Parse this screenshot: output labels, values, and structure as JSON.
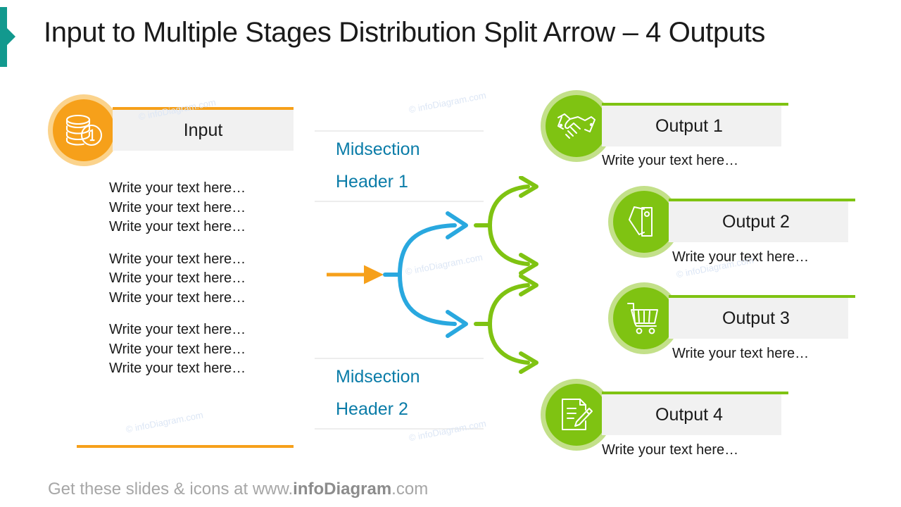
{
  "title": "Input to Multiple Stages Distribution Split Arrow – 4 Outputs",
  "colors": {
    "accent_teal": "#12998E",
    "input_orange": "#F6A01A",
    "input_orange_light": "#FBD38C",
    "mid_blue": "#0A7CA8",
    "arrow_blue": "#29A8DF",
    "output_green": "#7FC312",
    "output_green_light": "#C3E08A",
    "box_gray": "#F1F1F1",
    "rule_gray": "#EDEDED"
  },
  "input": {
    "icon": "coins-stack-icon",
    "label": "Input",
    "text_groups": [
      [
        "Write your text here…",
        "Write your text here…",
        "Write your text here…"
      ],
      [
        "Write your text here…",
        "Write your text here…",
        "Write your text here…"
      ],
      [
        "Write your text here…",
        "Write your text here…",
        "Write your text here…"
      ]
    ]
  },
  "midsections": [
    {
      "line1": "Midsection",
      "line2": "Header 1"
    },
    {
      "line1": "Midsection",
      "line2": "Header 2"
    }
  ],
  "outputs": [
    {
      "label": "Output 1",
      "caption": "Write your text here…",
      "icon": "handshake-icon"
    },
    {
      "label": "Output 2",
      "caption": "Write your text here…",
      "icon": "price-tags-icon"
    },
    {
      "label": "Output 3",
      "caption": "Write your text here…",
      "icon": "shopping-cart-icon"
    },
    {
      "label": "Output 4",
      "caption": "Write your text here…",
      "icon": "document-edit-icon"
    }
  ],
  "footer": {
    "prefix": "Get these slides & icons at www.",
    "brand": "infoDiagram",
    "suffix": ".com"
  },
  "watermark": "© infoDiagram.com"
}
